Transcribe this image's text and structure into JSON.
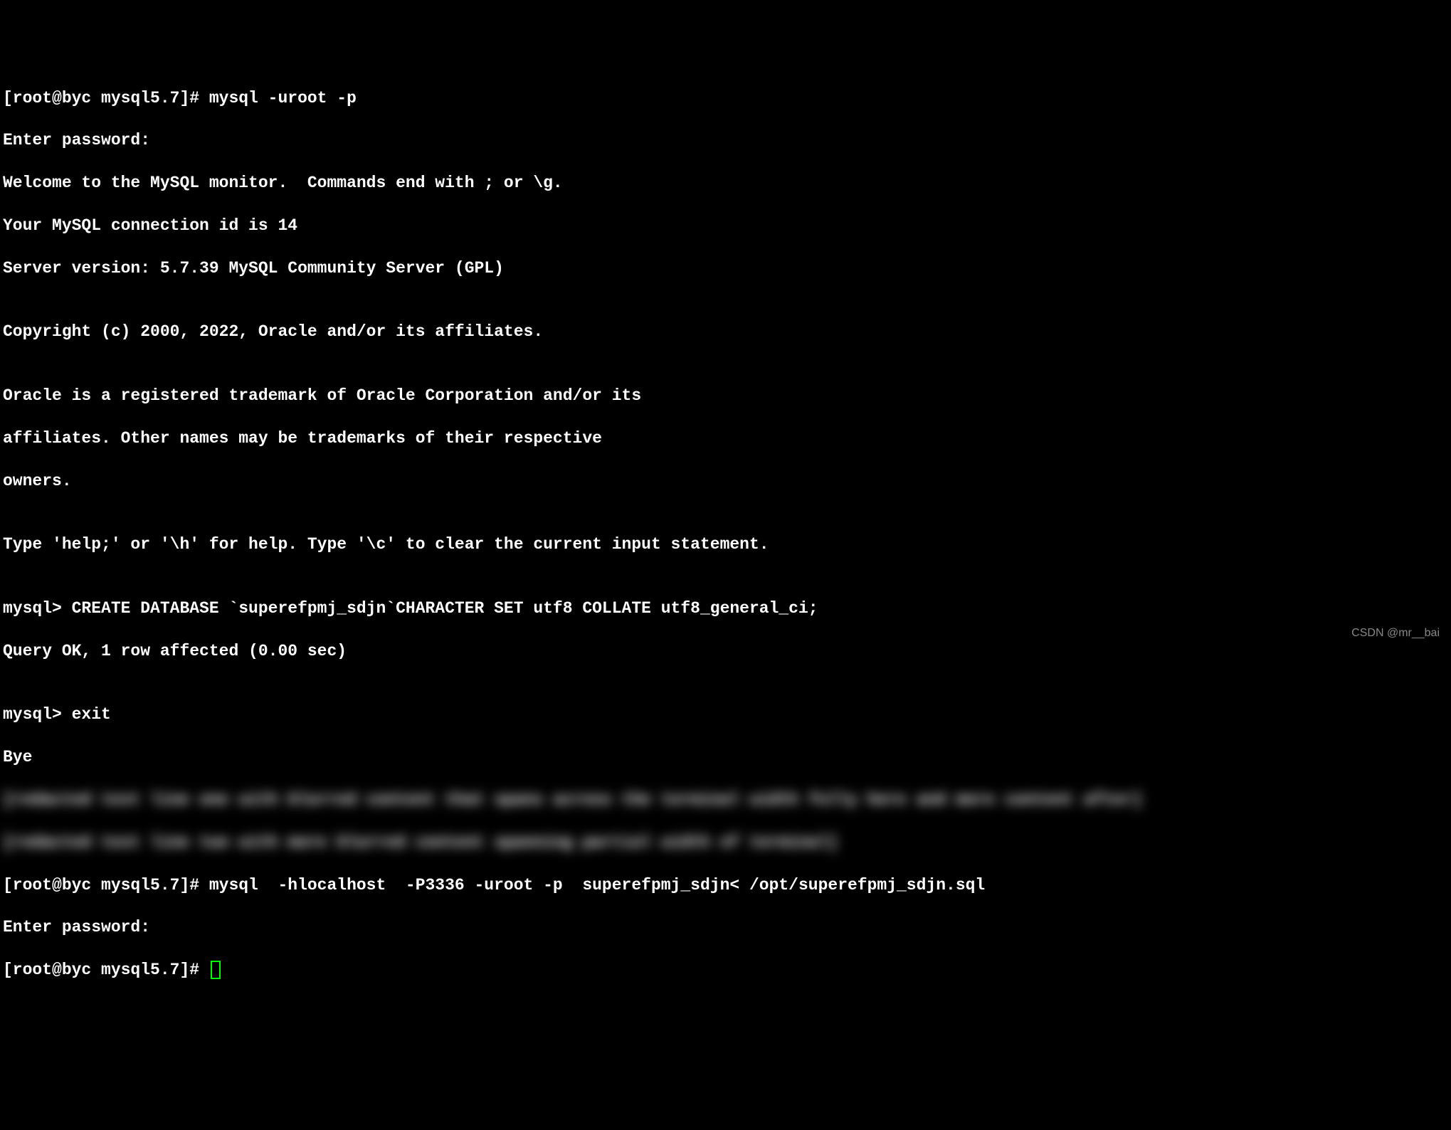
{
  "lines": {
    "l1": "[root@byc mysql5.7]# mysql -uroot -p",
    "l2": "Enter password:",
    "l3": "Welcome to the MySQL monitor.  Commands end with ; or \\g.",
    "l4": "Your MySQL connection id is 14",
    "l5": "Server version: 5.7.39 MySQL Community Server (GPL)",
    "l6": "",
    "l7": "Copyright (c) 2000, 2022, Oracle and/or its affiliates.",
    "l8": "",
    "l9": "Oracle is a registered trademark of Oracle Corporation and/or its",
    "l10": "affiliates. Other names may be trademarks of their respective",
    "l11": "owners.",
    "l12": "",
    "l13": "Type 'help;' or '\\h' for help. Type '\\c' to clear the current input statement.",
    "l14": "",
    "l15": "mysql> CREATE DATABASE `superefpmj_sdjn`CHARACTER SET utf8 COLLATE utf8_general_ci;",
    "l16": "Query OK, 1 row affected (0.00 sec)",
    "l17": "",
    "l18": "mysql> exit",
    "l19": "Bye",
    "l20_blur": "[redacted text line one with blurred content that spans across the terminal width fully here and more content after]",
    "l21_blur": "[redacted text line two with more blurred content spanning partial width of terminal]",
    "l22": "[root@byc mysql5.7]# mysql  -hlocalhost  -P3336 -uroot -p  superefpmj_sdjn< /opt/superefpmj_sdjn.sql",
    "l23": "Enter password:",
    "l24": "[root@byc mysql5.7]# "
  },
  "watermark": "CSDN @mr__bai"
}
